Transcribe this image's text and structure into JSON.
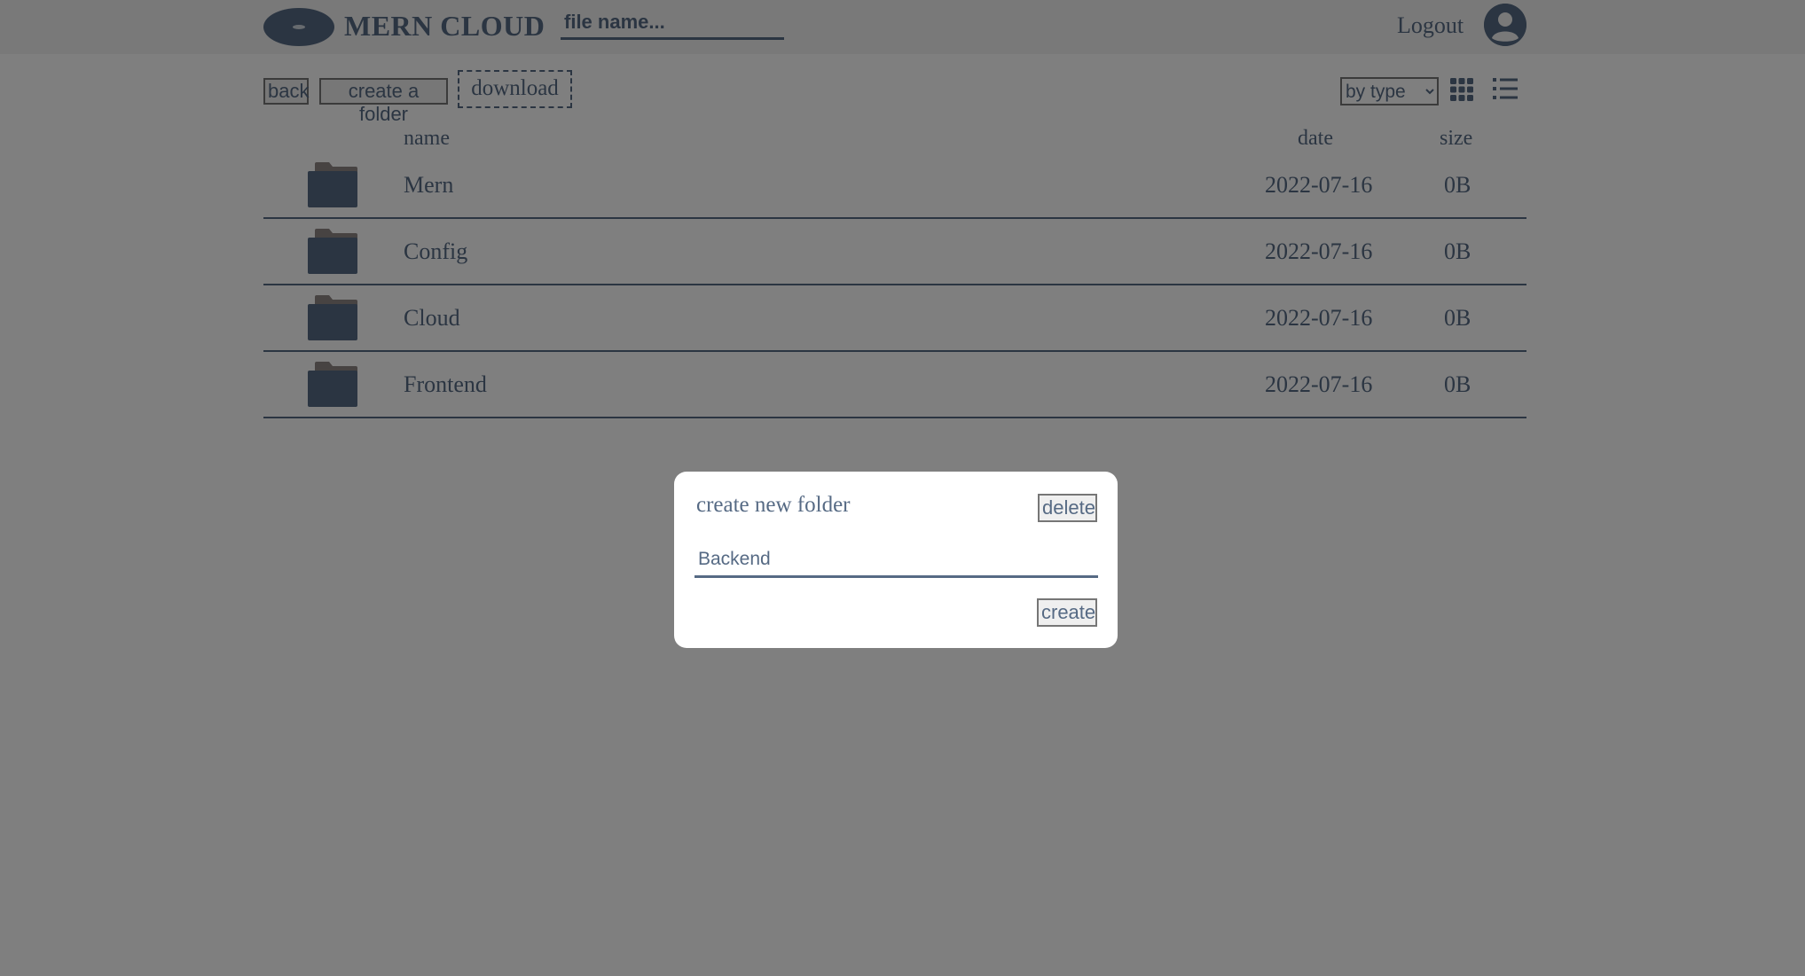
{
  "header": {
    "brand": "MERN CLOUD",
    "search_placeholder": "file name...",
    "logout_label": "Logout",
    "avatar_icon": "user-circle-icon"
  },
  "toolbar": {
    "back_label": "back",
    "create_folder_label": "create a folder",
    "download_label": "download",
    "sort_selected": "by type",
    "grid_view_icon": "grid-icon",
    "list_view_icon": "list-icon"
  },
  "table": {
    "columns": [
      "name",
      "date",
      "size"
    ],
    "rows": [
      {
        "name": "Mern",
        "date": "2022-07-16",
        "size": "0B",
        "icon": "folder-icon"
      },
      {
        "name": "Config",
        "date": "2022-07-16",
        "size": "0B",
        "icon": "folder-icon"
      },
      {
        "name": "Cloud",
        "date": "2022-07-16",
        "size": "0B",
        "icon": "folder-icon"
      },
      {
        "name": "Frontend",
        "date": "2022-07-16",
        "size": "0B",
        "icon": "folder-icon"
      }
    ]
  },
  "modal": {
    "title": "create new folder",
    "delete_label": "delete",
    "input_value": "Backend",
    "create_label": "create"
  },
  "colors": {
    "accent": "#566A84",
    "folder_body": "#566A84",
    "folder_tab": "#8F8684",
    "overlay": "rgba(0,0,0,0.5)"
  }
}
